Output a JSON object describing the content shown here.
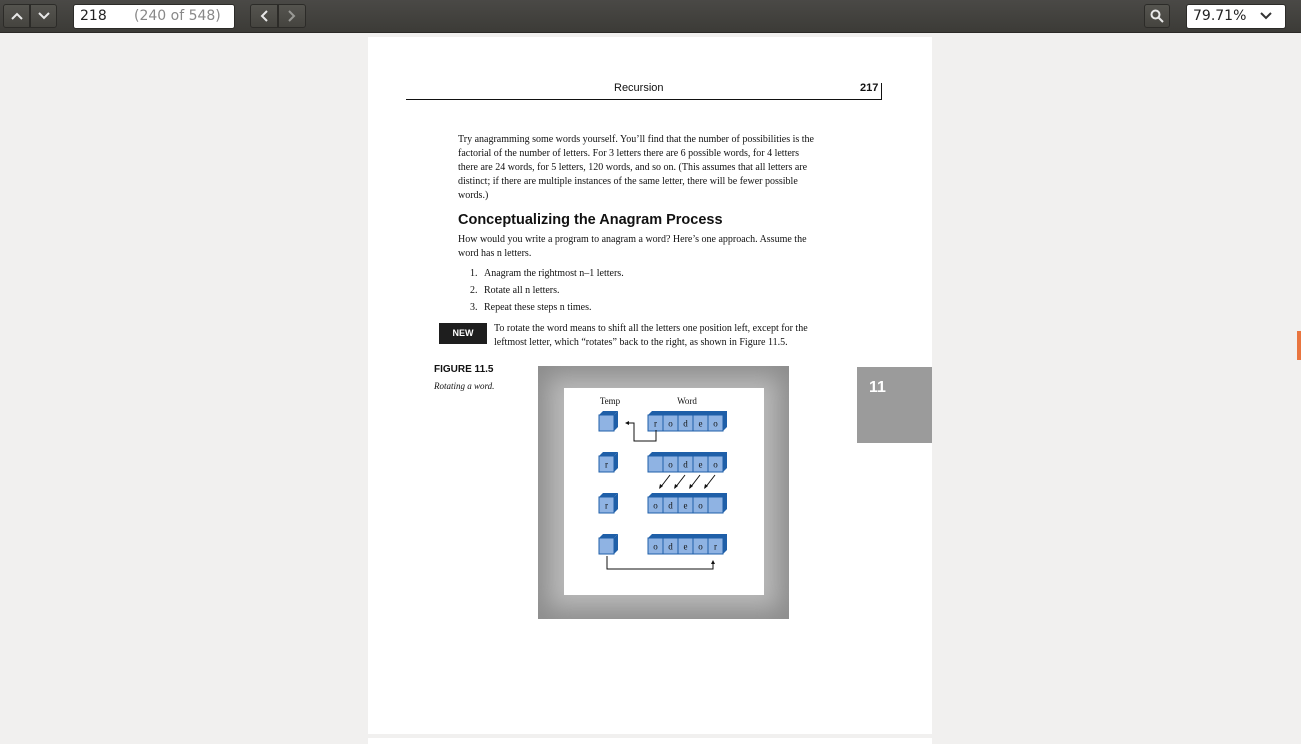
{
  "toolbar": {
    "page_current": "218",
    "page_total": "(240 of 548)",
    "zoom": "79.71%"
  },
  "page": {
    "running_title": "Recursion",
    "page_number": "217",
    "intro_paragraph": [
      "Try anagramming some words yourself. You’ll find that the number of possibilities is the",
      "factorial of the number of letters. For 3 letters there are 6 possible words, for 4 letters",
      "there are 24 words, for 5 letters, 120 words, and so on. (This assumes that all letters are",
      "distinct; if there are multiple instances of the same letter, there will be fewer possible",
      "words.)"
    ],
    "section_heading": "Conceptualizing the Anagram Process",
    "question_lines": [
      "How would you write a program to anagram a word? Here’s one approach. Assume the",
      "word has n letters."
    ],
    "steps": [
      {
        "n": "1.",
        "text": "Anagram the rightmost n–1 letters."
      },
      {
        "n": "2.",
        "text": "Rotate all n letters."
      },
      {
        "n": "3.",
        "text": "Repeat these steps n times."
      }
    ],
    "new_term_badge": "NEW TERM",
    "new_term_lines": [
      "To rotate the word means to shift all the letters one position left, except for the",
      "leftmost letter, which “rotates” back to the right, as shown in Figure 11.5."
    ],
    "figure_title": "FIGURE 11.5",
    "figure_caption": "Rotating a word.",
    "figure": {
      "temp_label": "Temp",
      "word_label": "Word",
      "rows": [
        {
          "temp": "",
          "word": [
            "r",
            "o",
            "d",
            "e",
            "o"
          ]
        },
        {
          "temp": "r",
          "word": [
            "",
            "o",
            "d",
            "e",
            "o"
          ]
        },
        {
          "temp": "r",
          "word": [
            "o",
            "d",
            "e",
            "o",
            ""
          ]
        },
        {
          "temp": "",
          "word": [
            "o",
            "d",
            "e",
            "o",
            "r"
          ]
        }
      ]
    },
    "chapter_tab": "11"
  },
  "colors": {
    "toolbar": "#3c3b37",
    "cube_front": "#8fb3e3",
    "cube_side": "#1f5fa8",
    "scroll_marker": "#e9753f"
  }
}
